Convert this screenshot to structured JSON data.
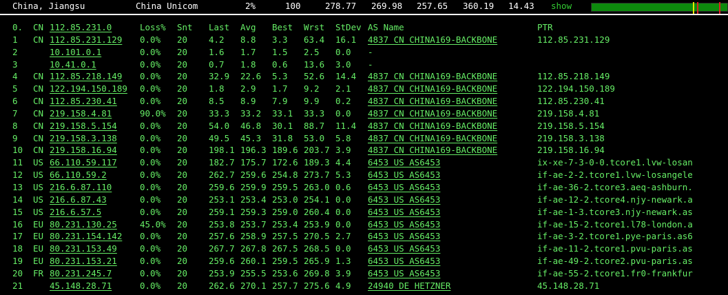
{
  "colors": {
    "background": "#000000",
    "text": "#66ee66",
    "header_text": "#ffffff",
    "bar_green": "#0d8a0d",
    "tick_yellow": "#e6e600",
    "tick_red": "#dd2222"
  },
  "header": {
    "location": "China, Jiangsu",
    "isp": "China Unicom",
    "loss": "2%",
    "sent": "100",
    "last": "278.77",
    "avg": "269.98",
    "best": "257.65",
    "worst": "360.19",
    "stdev": "14.43",
    "show_label": "show"
  },
  "table": {
    "columns": {
      "loss": "Loss%",
      "snt": "Snt",
      "last": "Last",
      "avg": "Avg",
      "best": "Best",
      "wrst": "Wrst",
      "stdev": "StDev",
      "asname": "AS Name",
      "ptr": "PTR"
    },
    "header_row": {
      "hop": "0.",
      "cc": "CN",
      "ip": "112.85.231.0"
    },
    "rows": [
      {
        "hop": "1",
        "cc": "CN",
        "ip": "112.85.231.129",
        "loss": "0.0%",
        "snt": "20",
        "last": "4.2",
        "avg": "8.8",
        "best": "3.3",
        "wrst": "63.4",
        "stdev": "16.1",
        "asname": "4837  CN CHINA169-BACKBONE",
        "ptr": "112.85.231.129"
      },
      {
        "hop": "2",
        "cc": "",
        "ip": "10.101.0.1",
        "loss": "0.0%",
        "snt": "20",
        "last": "1.6",
        "avg": "1.7",
        "best": "1.5",
        "wrst": "2.5",
        "stdev": "0.0",
        "asname": "-",
        "ptr": ""
      },
      {
        "hop": "3",
        "cc": "",
        "ip": "10.41.0.1",
        "loss": "0.0%",
        "snt": "20",
        "last": "0.7",
        "avg": "1.8",
        "best": "0.6",
        "wrst": "13.6",
        "stdev": "3.0",
        "asname": "-",
        "ptr": ""
      },
      {
        "hop": "4",
        "cc": "CN",
        "ip": "112.85.218.149",
        "loss": "0.0%",
        "snt": "20",
        "last": "32.9",
        "avg": "22.6",
        "best": "5.3",
        "wrst": "52.6",
        "stdev": "14.4",
        "asname": "4837  CN CHINA169-BACKBONE",
        "ptr": "112.85.218.149"
      },
      {
        "hop": "5",
        "cc": "CN",
        "ip": "122.194.150.189",
        "loss": "0.0%",
        "snt": "20",
        "last": "1.8",
        "avg": "2.9",
        "best": "1.7",
        "wrst": "9.2",
        "stdev": "2.1",
        "asname": "4837  CN CHINA169-BACKBONE",
        "ptr": "122.194.150.189"
      },
      {
        "hop": "6",
        "cc": "CN",
        "ip": "112.85.230.41",
        "loss": "0.0%",
        "snt": "20",
        "last": "8.5",
        "avg": "8.9",
        "best": "7.9",
        "wrst": "9.9",
        "stdev": "0.2",
        "asname": "4837  CN CHINA169-BACKBONE",
        "ptr": "112.85.230.41"
      },
      {
        "hop": "7",
        "cc": "CN",
        "ip": "219.158.4.81",
        "loss": "90.0%",
        "snt": "20",
        "last": "33.3",
        "avg": "33.2",
        "best": "33.1",
        "wrst": "33.3",
        "stdev": "0.0",
        "asname": "4837  CN CHINA169-BACKBONE",
        "ptr": "219.158.4.81"
      },
      {
        "hop": "8",
        "cc": "CN",
        "ip": "219.158.5.154",
        "loss": "0.0%",
        "snt": "20",
        "last": "54.0",
        "avg": "46.8",
        "best": "30.1",
        "wrst": "88.7",
        "stdev": "11.4",
        "asname": "4837  CN CHINA169-BACKBONE",
        "ptr": "219.158.5.154"
      },
      {
        "hop": "9",
        "cc": "CN",
        "ip": "219.158.3.138",
        "loss": "0.0%",
        "snt": "20",
        "last": "49.5",
        "avg": "45.3",
        "best": "31.8",
        "wrst": "53.0",
        "stdev": "5.8",
        "asname": "4837  CN CHINA169-BACKBONE",
        "ptr": "219.158.3.138"
      },
      {
        "hop": "10",
        "cc": "CN",
        "ip": "219.158.16.94",
        "loss": "0.0%",
        "snt": "20",
        "last": "198.1",
        "avg": "196.3",
        "best": "189.6",
        "wrst": "203.7",
        "stdev": "3.9",
        "asname": "4837  CN CHINA169-BACKBONE",
        "ptr": "219.158.16.94"
      },
      {
        "hop": "11",
        "cc": "US",
        "ip": "66.110.59.117",
        "loss": "0.0%",
        "snt": "20",
        "last": "182.7",
        "avg": "175.7",
        "best": "172.6",
        "wrst": "189.3",
        "stdev": "4.4",
        "asname": "6453  US AS6453",
        "ptr": "ix-xe-7-3-0-0.tcore1.lvw-losan"
      },
      {
        "hop": "12",
        "cc": "US",
        "ip": "66.110.59.2",
        "loss": "0.0%",
        "snt": "20",
        "last": "262.7",
        "avg": "259.6",
        "best": "254.8",
        "wrst": "273.7",
        "stdev": "5.3",
        "asname": "6453  US AS6453",
        "ptr": "if-ae-2-2.tcore1.lvw-losangele"
      },
      {
        "hop": "13",
        "cc": "US",
        "ip": "216.6.87.110",
        "loss": "0.0%",
        "snt": "20",
        "last": "259.6",
        "avg": "259.9",
        "best": "259.5",
        "wrst": "263.0",
        "stdev": "0.6",
        "asname": "6453  US AS6453",
        "ptr": "if-ae-36-2.tcore3.aeq-ashburn."
      },
      {
        "hop": "14",
        "cc": "US",
        "ip": "216.6.87.43",
        "loss": "0.0%",
        "snt": "20",
        "last": "253.1",
        "avg": "253.4",
        "best": "253.0",
        "wrst": "254.1",
        "stdev": "0.0",
        "asname": "6453  US AS6453",
        "ptr": "if-ae-12-2.tcore4.njy-newark.a"
      },
      {
        "hop": "15",
        "cc": "US",
        "ip": "216.6.57.5",
        "loss": "0.0%",
        "snt": "20",
        "last": "259.1",
        "avg": "259.3",
        "best": "259.0",
        "wrst": "260.4",
        "stdev": "0.0",
        "asname": "6453  US AS6453",
        "ptr": "if-ae-1-3.tcore3.njy-newark.as"
      },
      {
        "hop": "16",
        "cc": "EU",
        "ip": "80.231.130.25",
        "loss": "45.0%",
        "snt": "20",
        "last": "253.8",
        "avg": "253.7",
        "best": "253.4",
        "wrst": "253.9",
        "stdev": "0.0",
        "asname": "6453  US AS6453",
        "ptr": "if-ae-15-2.tcore1.l78-london.a"
      },
      {
        "hop": "17",
        "cc": "EU",
        "ip": "80.231.154.142",
        "loss": "0.0%",
        "snt": "20",
        "last": "257.6",
        "avg": "258.9",
        "best": "257.5",
        "wrst": "270.5",
        "stdev": "2.7",
        "asname": "6453  US AS6453",
        "ptr": "if-ae-3-2.tcore1.pye-paris.as6"
      },
      {
        "hop": "18",
        "cc": "EU",
        "ip": "80.231.153.49",
        "loss": "0.0%",
        "snt": "20",
        "last": "267.7",
        "avg": "267.8",
        "best": "267.5",
        "wrst": "268.5",
        "stdev": "0.0",
        "asname": "6453  US AS6453",
        "ptr": "if-ae-11-2.tcore1.pvu-paris.as"
      },
      {
        "hop": "19",
        "cc": "EU",
        "ip": "80.231.153.21",
        "loss": "0.0%",
        "snt": "20",
        "last": "259.6",
        "avg": "260.1",
        "best": "259.5",
        "wrst": "265.9",
        "stdev": "1.3",
        "asname": "6453  US AS6453",
        "ptr": "if-ae-49-2.tcore2.pvu-paris.as"
      },
      {
        "hop": "20",
        "cc": "FR",
        "ip": "80.231.245.7",
        "loss": "0.0%",
        "snt": "20",
        "last": "253.9",
        "avg": "255.5",
        "best": "253.6",
        "wrst": "269.8",
        "stdev": "3.9",
        "asname": "6453  US AS6453",
        "ptr": "if-ae-55-2.tcore1.fr0-frankfur"
      },
      {
        "hop": "21",
        "cc": "",
        "ip": "45.148.28.71",
        "loss": "0.0%",
        "snt": "20",
        "last": "262.6",
        "avg": "270.1",
        "best": "257.7",
        "wrst": "275.6",
        "stdev": "4.9",
        "asname": "24940 DE HETZNER",
        "ptr": "45.148.28.71"
      }
    ]
  }
}
